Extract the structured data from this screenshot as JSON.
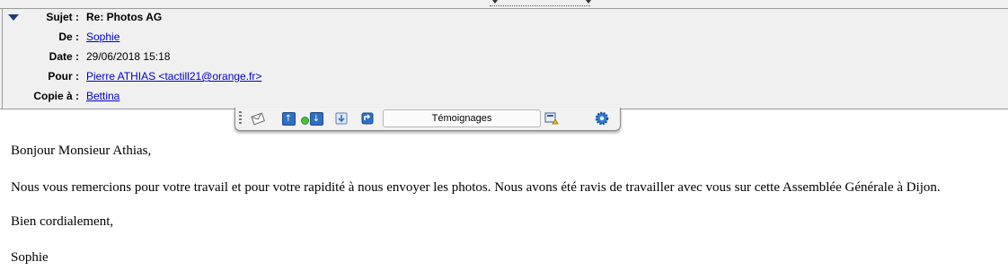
{
  "header": {
    "fields": [
      {
        "label": "Sujet :",
        "value": "Re: Photos AG",
        "link": false
      },
      {
        "label": "De :",
        "value": " Sophie ",
        "link": true
      },
      {
        "label": "Date :",
        "value": "29/06/2018 15:18",
        "link": false
      },
      {
        "label": "Pour :",
        "value": "Pierre ATHIAS <tactill21@orange.fr>",
        "link": true
      },
      {
        "label": "Copie à :",
        "value": "Bettina",
        "link": true
      }
    ]
  },
  "toolbar": {
    "field_value": "Témoignages",
    "icons": [
      "envelope-icon",
      "arrow-up-icon",
      "green-dot-icon",
      "arrow-down-icon",
      "folder-download-icon",
      "reply-icon",
      "export-icon",
      "gear-icon"
    ]
  },
  "message": {
    "greeting": "Bonjour Monsieur Athias,",
    "paragraph": "Nous vous remercions pour votre travail et pour votre rapidité à nous envoyer les photos. Nous avons été ravis de travailler avec vous sur cette Assemblée Générale à Dijon.",
    "closing": "Bien cordialement,",
    "signature": "Sophie"
  }
}
